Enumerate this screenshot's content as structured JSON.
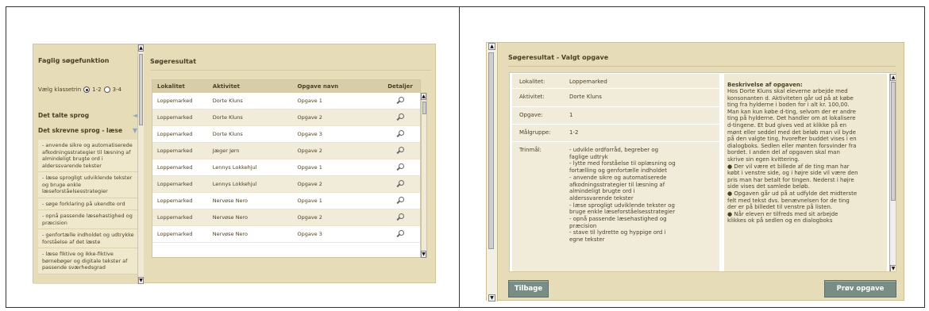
{
  "left_screen": {
    "sidebar": {
      "title": "Faglig søgefunktion",
      "klasse_label": "Vælg klassetrin",
      "klasse_options": [
        "1-2",
        "3-4"
      ],
      "klasse_selected": "1-2",
      "sections": [
        {
          "label": "Det talte sprog",
          "arrow": "◄"
        },
        {
          "label": "Det skrevne sprog - læse",
          "arrow": "▼"
        }
      ],
      "items": [
        "- anvende sikre og automatiserede afkodningsstrategier til læsning af almindeligt brugte ord i alderssvarende tekster",
        "- læse sprogligt udviklende tekster og bruge enkle læseforståelsesstrategier",
        "- søge forklaring på ukendte ord",
        "- opnå passende læsehastighed og præcision",
        "- genfortælle indholdet og udtrykke forståelse af det læste",
        "- læse fiktive og ikke-fiktive børnebøger og digitale tekster af passende sværhedsgrad"
      ]
    },
    "results": {
      "title": "Søgeresultat",
      "columns": [
        "Lokalitet",
        "Aktivitet",
        "Opgave navn",
        "Detaljer"
      ],
      "rows": [
        [
          "Loppemarked",
          "Dorte Kluns",
          "Opgave 1"
        ],
        [
          "Loppemarked",
          "Dorte Kluns",
          "Opgave 2"
        ],
        [
          "Loppemarked",
          "Dorte Kluns",
          "Opgave 3"
        ],
        [
          "Loppemarked",
          "Jæger Jørn",
          "Opgave 2"
        ],
        [
          "Loppemarked",
          "Lennys Lokkehjul",
          "Opgave 1"
        ],
        [
          "Loppemarked",
          "Lennys Lokkehjul",
          "Opgave 2"
        ],
        [
          "Loppemarked",
          "Nervøse Nero",
          "Opgave 1"
        ],
        [
          "Loppemarked",
          "Nervøse Nero",
          "Opgave 2"
        ],
        [
          "Loppemarked",
          "Nervøse Nero",
          "Opgave 3"
        ]
      ]
    }
  },
  "right_screen": {
    "title": "Søgeresultat - Valgt opgave",
    "fields": [
      {
        "key": "Lokalitet:",
        "value": "Loppemarked"
      },
      {
        "key": "Aktivitet:",
        "value": "Dorte Kluns"
      },
      {
        "key": "Opgave:",
        "value": "1"
      },
      {
        "key": "Målgruppe:",
        "value": "1-2"
      },
      {
        "key": "Trinmål:",
        "value": "- udvikle ordforråd, begreber og\nfaglige udtryk\n- lytte med forståelse til oplæsning og\nfortælling og genfortælle indholdet\n- anvende sikre og automatiserede\nafkodningsstrategier til læsning af\nalmindeligt brugte ord i\nalderssvarende tekster\n- læse sprogligt udviklende tekster og\nbruge enkle læseforståelsesstrategier\n- opnå passende læsehastighed og\npræcision\n- stave til lydrette og hyppige ord i\negne tekster"
      }
    ],
    "description_title": "Beskrivelse af opgaven:",
    "description": "Hos Dorte Kluns skal eleverne arbejde med\nkonsonanten d. Aktiviteten går ud på at købe\nting fra hylderne i boden for i alt kr. 100,00.\nMan kan kun købe d-ting, selvom der er andre\nting på hylderne. Det handler om at lokalisere\nd-tingene. Et bud gives ved at klikke på en\nmønt eller seddel med det beløb man vil byde\npå den valgte ting, hvorefter buddet vises i en\ndialogboks. Sedlen eller mønten forsvinder fra\nbordet. I anden del af opgaven skal man\nskrive sin egen kvittering.\n● Der vil være et billede af de ting man har\nkøbt i venstre side, og i højre side vil være den\npris man har betalt for tingen. Nederst i højre\nside vises det samlede beløb.\n● Opgaven går ud på at udfylde det midterste\nfelt med tekst dvs. benævnelsen for de ting\nder er på billedet til venstre på listen.\n● Når eleven er tilfreds med sit arbejde\nklikkes ok på sedlen og en dialogboks",
    "back_button": "Tilbage",
    "try_button": "Prøv opgave"
  },
  "icons": {
    "details": "magnifier-icon",
    "scroll_up": "▲",
    "scroll_down": "▼"
  }
}
